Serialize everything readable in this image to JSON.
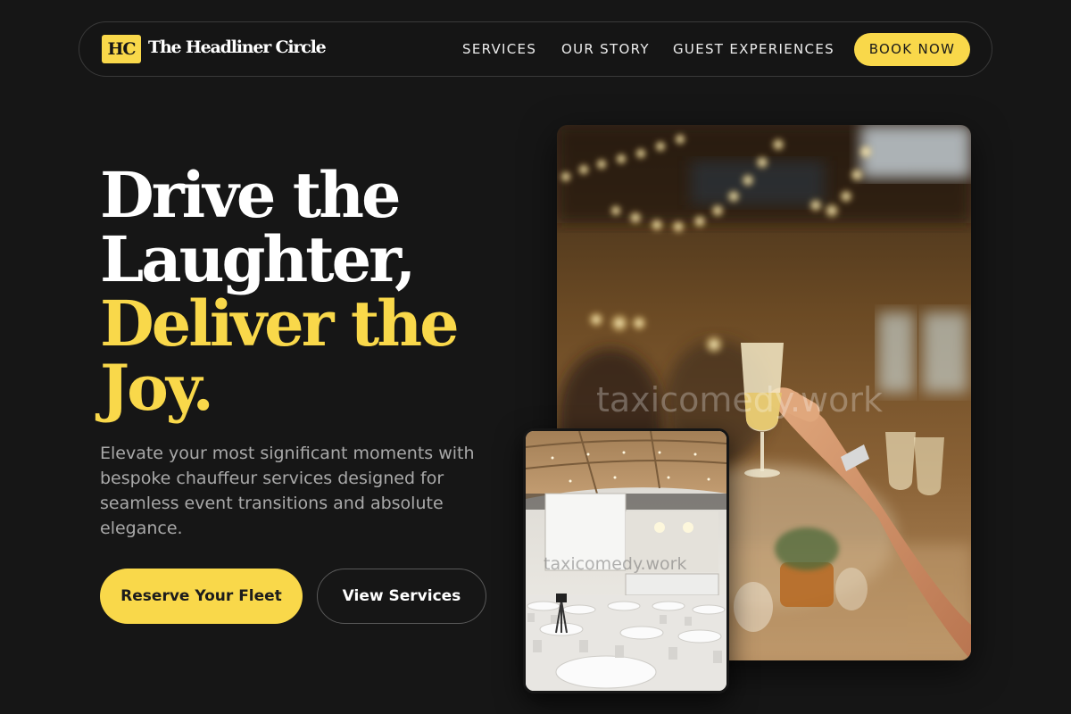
{
  "nav": {
    "logo_badge": "HC",
    "logo_text": "The Headliner Circle",
    "links": [
      "SERVICES",
      "OUR STORY",
      "GUEST EXPERIENCES"
    ],
    "cta": "BOOK NOW"
  },
  "hero": {
    "headline_line1": "Drive the",
    "headline_line2": "Laughter,",
    "headline_line3": "Deliver the",
    "headline_line4": "Joy.",
    "subtext": "Elevate your most significant moments with bespoke chauffeur services designed for seamless event transitions and absolute elegance.",
    "primary_button": "Reserve Your Fleet",
    "secondary_button": "View Services"
  },
  "images": {
    "main_watermark": "taxicomedy.work",
    "small_watermark": "taxicomedy.work"
  },
  "colors": {
    "background": "#161616",
    "accent": "#f9d84a",
    "text_muted": "#a9a9a9"
  }
}
